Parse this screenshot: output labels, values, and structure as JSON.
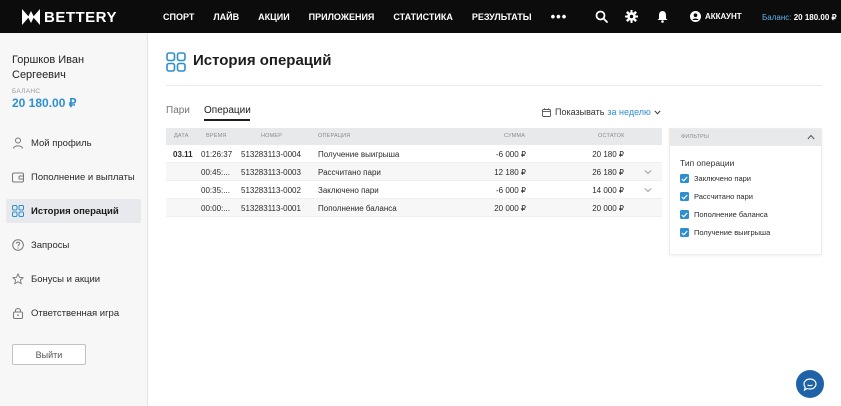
{
  "brand": {
    "name": "BETTERY"
  },
  "nav": {
    "items": [
      "СПОРТ",
      "ЛАЙВ",
      "АКЦИИ",
      "ПРИЛОЖЕНИЯ",
      "СТАТИСТИКА",
      "РЕЗУЛЬТАТЫ"
    ],
    "more": "•••"
  },
  "topbar": {
    "account_label": "АККАУНТ",
    "balance_label": "Баланс:",
    "balance_value": "20 180.00 ₽"
  },
  "user": {
    "name": "Горшков Иван Сергеевич",
    "balance_label": "БАЛАНС",
    "balance_value": "20 180.00 ₽"
  },
  "sidebar": {
    "items": [
      {
        "label": "Мой профиль",
        "icon": "user-icon"
      },
      {
        "label": "Пополнение и выплаты",
        "icon": "wallet-icon"
      },
      {
        "label": "История операций",
        "icon": "grid-icon",
        "active": true
      },
      {
        "label": "Запросы",
        "icon": "question-icon"
      },
      {
        "label": "Бонусы и акции",
        "icon": "star-icon"
      },
      {
        "label": "Ответственная игра",
        "icon": "lock-icon"
      }
    ],
    "logout_label": "Выйти"
  },
  "page": {
    "title": "История операций"
  },
  "tabs": {
    "bets": "Пари",
    "operations": "Операции"
  },
  "period": {
    "label": "Показывать",
    "value": "за неделю"
  },
  "table": {
    "headers": {
      "date": "ДАТА",
      "time": "ВРЕМЯ",
      "number": "НОМЕР",
      "operation": "ОПЕРАЦИЯ",
      "amount": "СУММА",
      "balance": "ОСТАТОК"
    },
    "rows": [
      {
        "date": "03.11",
        "time": "01:26:37",
        "number": "513283113-0004",
        "operation": "Получение выигрыша",
        "amount": "-6 000 ₽",
        "balance": "20 180 ₽",
        "expandable": false
      },
      {
        "date": "",
        "time": "00:45:...",
        "number": "513283113-0003",
        "operation": "Рассчитано пари",
        "amount": "12 180 ₽",
        "balance": "26 180 ₽",
        "expandable": true
      },
      {
        "date": "",
        "time": "00:35:...",
        "number": "513283113-0002",
        "operation": "Заключено пари",
        "amount": "-6 000 ₽",
        "balance": "14 000 ₽",
        "expandable": true
      },
      {
        "date": "",
        "time": "00:00:...",
        "number": "513283113-0001",
        "operation": "Пополнение баланса",
        "amount": "20 000 ₽",
        "balance": "20 000 ₽",
        "expandable": false
      }
    ]
  },
  "filters": {
    "title": "ФИЛЬТРЫ",
    "group_label": "Тип операции",
    "options": [
      "Заключено пари",
      "Рассчитано пари",
      "Пополнение баланса",
      "Получение выигрыша"
    ]
  },
  "colors": {
    "accent": "#2e8fcf",
    "topbar": "#0c0c0c",
    "chat": "#1e62a8"
  }
}
